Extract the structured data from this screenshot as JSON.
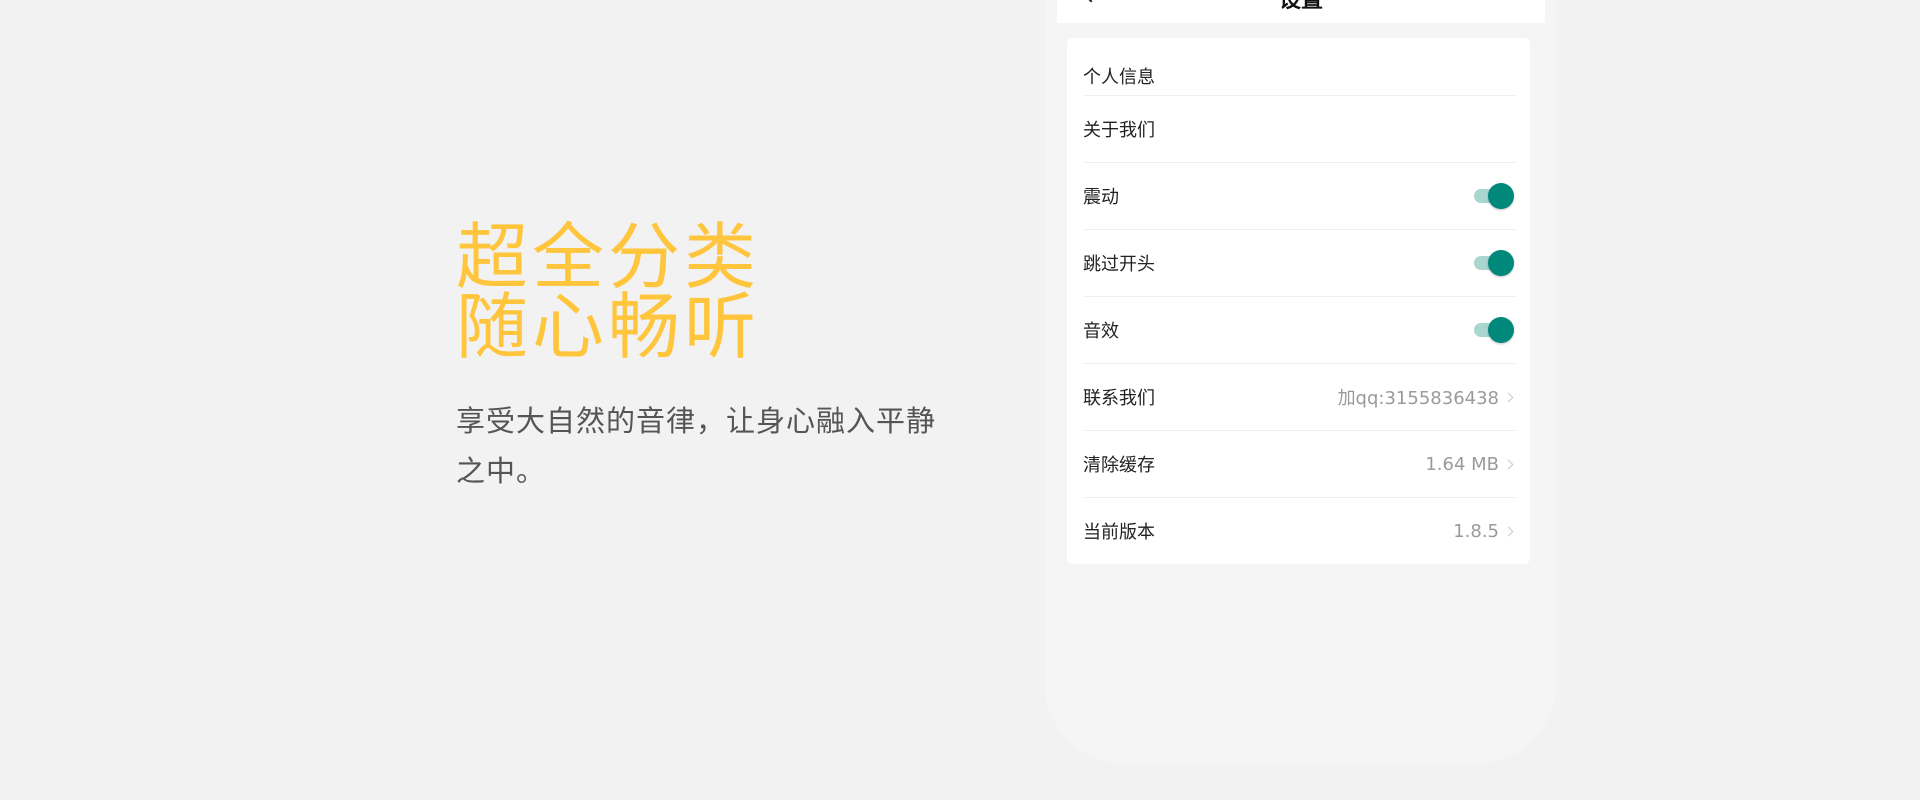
{
  "promo": {
    "headline_line1": "超全分类",
    "headline_line2": "随心畅听",
    "subtext": "享受大自然的音律，让身心融入平静之中。"
  },
  "phone": {
    "title": "设置",
    "settings": {
      "personal_info": "个人信息",
      "about_us": "关于我们",
      "vibration": {
        "label": "震动",
        "enabled": true
      },
      "skip_intro": {
        "label": "跳过开头",
        "enabled": true
      },
      "sound_effects": {
        "label": "音效",
        "enabled": true
      },
      "contact_us": {
        "label": "联系我们",
        "value": "加qq:3155836438"
      },
      "clear_cache": {
        "label": "清除缓存",
        "value": "1.64 MB"
      },
      "current_version": {
        "label": "当前版本",
        "value": "1.8.5"
      }
    }
  },
  "colors": {
    "headline": "#ffc53d",
    "toggle_on": "#00897b",
    "toggle_track": "#a9d6cf",
    "background": "#f2f2f2"
  },
  "icons": {
    "back": "back-arrow-icon",
    "chevron": "chevron-right-icon"
  }
}
